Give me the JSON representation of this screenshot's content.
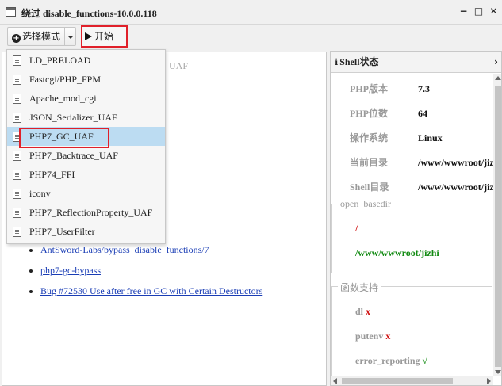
{
  "window": {
    "title": "绕过 disable_functions-10.0.0.118",
    "controls": {
      "minimize": "−",
      "maximize": "□",
      "close": "✕"
    }
  },
  "toolbar": {
    "mode_label": "选择模式",
    "start_label": "开始"
  },
  "mode_menu": {
    "items": [
      {
        "label": "LD_PRELOAD"
      },
      {
        "label": "Fastcgi/PHP_FPM"
      },
      {
        "label": "Apache_mod_cgi"
      },
      {
        "label": "JSON_Serializer_UAF"
      },
      {
        "label": "PHP7_GC_UAF"
      },
      {
        "label": "PHP7_Backtrace_UAF"
      },
      {
        "label": "PHP74_FFI"
      },
      {
        "label": "iconv"
      },
      {
        "label": "PHP7_ReflectionProperty_UAF"
      },
      {
        "label": "PHP7_UserFilter"
      }
    ],
    "selected": "PHP7_GC_UAF"
  },
  "main": {
    "faded_text": "UAF",
    "links": [
      "AntSword-Labs/bypass_disable_functions/7",
      "php7-gc-bypass",
      "Bug #72530 Use after free in GC with Certain Destructors"
    ]
  },
  "shell_status": {
    "title": "Shell状态",
    "rows": [
      {
        "key": "PHP版本",
        "value": "7.3"
      },
      {
        "key": "PHP位数",
        "value": "64"
      },
      {
        "key": "操作系统",
        "value": "Linux"
      },
      {
        "key": "当前目录",
        "value": "/www/wwwroot/jiz"
      },
      {
        "key": "Shell目录",
        "value": "/www/wwwroot/jiz"
      }
    ],
    "open_basedir": {
      "legend": "open_basedir",
      "paths": [
        "/",
        "/www/wwwroot/jizhi"
      ]
    },
    "functions": {
      "legend": "函数支持",
      "items": [
        {
          "name": "dl",
          "mark": "x"
        },
        {
          "name": "putenv",
          "mark": "x"
        },
        {
          "name": "error_reporting",
          "mark": "√"
        }
      ]
    }
  }
}
